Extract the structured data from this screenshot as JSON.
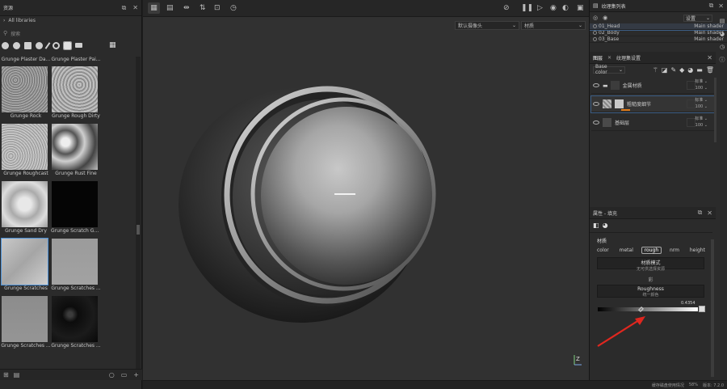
{
  "shelf": {
    "title": "资源",
    "library_path": "All libraries",
    "search_placeholder": "搜索",
    "tiles": [
      {
        "label": "Grunge Plaster Da...",
        "kind": "none"
      },
      {
        "label": "Grunge Plaster Pai...",
        "kind": "none"
      },
      {
        "label": "Grunge Rock",
        "kind": "rock"
      },
      {
        "label": "Grunge Rough Dirty",
        "kind": "rough"
      },
      {
        "label": "Grunge Roughcast",
        "kind": "cast"
      },
      {
        "label": "Grunge Rust Fine",
        "kind": "rust"
      },
      {
        "label": "Grunge Sand Dry",
        "kind": "sand"
      },
      {
        "label": "Grunge Scratch Ge...",
        "kind": "black"
      },
      {
        "label": "Grunge Scratches",
        "kind": "scratch"
      },
      {
        "label": "Grunge Scratches ...",
        "kind": "flat"
      },
      {
        "label": "Grunge Scratches ...",
        "kind": "grey"
      },
      {
        "label": "Grunge Scratches ...",
        "kind": "dark"
      }
    ]
  },
  "viewport": {
    "camera_select": "默认摄像头",
    "env_select": "材质",
    "axis_label": "Z"
  },
  "texture_sets": {
    "title": "纹理集列表",
    "dropdown": "设置",
    "items": [
      {
        "name": "01_Head",
        "shader": "Main shader"
      },
      {
        "name": "02_Body",
        "shader": "Main shader"
      },
      {
        "name": "03_Base",
        "shader": "Main shader"
      }
    ]
  },
  "layers": {
    "tabs": [
      "图层",
      "纹理集设置"
    ],
    "channel_select": "Base color",
    "items": [
      {
        "name": "金属材质",
        "blend": "标准",
        "opacity": "100",
        "selected": false,
        "type": "folder"
      },
      {
        "name": "粗糙度细节",
        "blend": "标准",
        "opacity": "100",
        "selected": true,
        "type": "fill"
      },
      {
        "name": "基础层",
        "blend": "标准",
        "opacity": "100",
        "selected": false,
        "type": "paint"
      }
    ]
  },
  "properties": {
    "header": "属性 - 填充",
    "section": "材质",
    "channels": [
      {
        "label": "color",
        "on": false
      },
      {
        "label": "metal",
        "on": false
      },
      {
        "label": "rough",
        "on": true
      },
      {
        "label": "nrm",
        "on": false
      },
      {
        "label": "height",
        "on": false
      }
    ],
    "mode_title": "材质模式",
    "mode_value": "无可供选择资源",
    "sub_section": "彩",
    "roughness_title": "Roughness",
    "roughness_sub": "统一颜色",
    "roughness_value": "0.4354",
    "roughness_fraction": 0.4354
  },
  "status": {
    "cache": "缓存磁盘使用情况",
    "pct": "58%",
    "version": "版本: 7.2.0"
  },
  "colors": {
    "accent_blue": "#4a8fd6",
    "arrow_red": "#e0271f",
    "mask_orange": "#e07b18"
  }
}
